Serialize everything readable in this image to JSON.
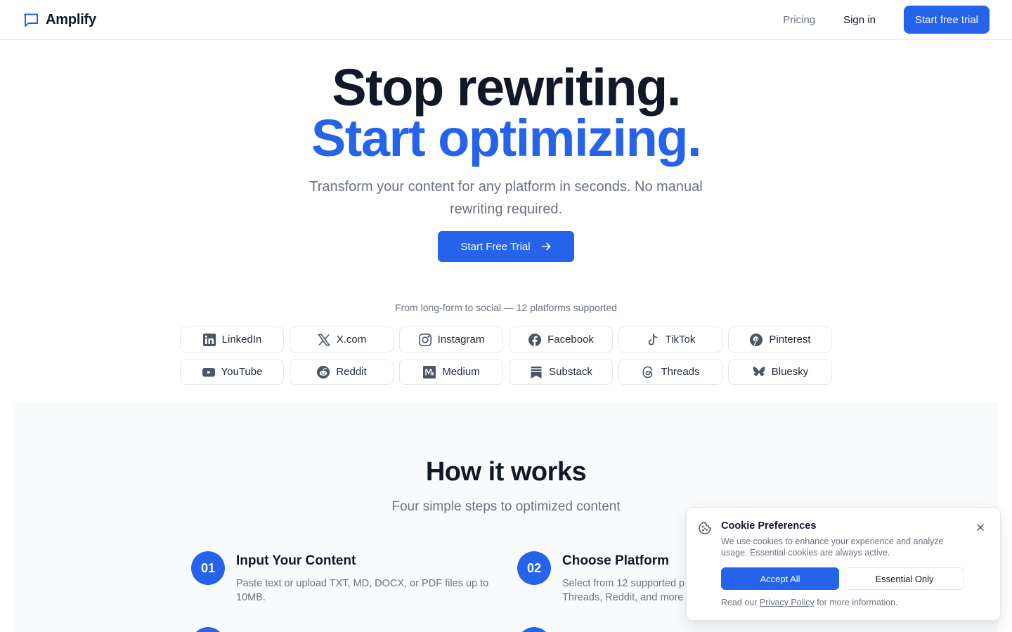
{
  "header": {
    "brand": "Amplify",
    "nav_pricing": "Pricing",
    "nav_signin": "Sign in",
    "cta": "Start free trial"
  },
  "hero": {
    "line1": "Stop rewriting.",
    "line2": "Start optimizing.",
    "subtitle": "Transform your content for any platform in seconds. No manual rewriting required.",
    "cta": "Start Free Trial"
  },
  "platforms": {
    "caption": "From long-form to social — 12 platforms supported",
    "items": [
      {
        "label": "LinkedIn",
        "icon": "linkedin-icon"
      },
      {
        "label": "X.com",
        "icon": "x-icon"
      },
      {
        "label": "Instagram",
        "icon": "instagram-icon"
      },
      {
        "label": "Facebook",
        "icon": "facebook-icon"
      },
      {
        "label": "TikTok",
        "icon": "tiktok-icon"
      },
      {
        "label": "Pinterest",
        "icon": "pinterest-icon"
      },
      {
        "label": "YouTube",
        "icon": "youtube-icon"
      },
      {
        "label": "Reddit",
        "icon": "reddit-icon"
      },
      {
        "label": "Medium",
        "icon": "medium-icon"
      },
      {
        "label": "Substack",
        "icon": "substack-icon"
      },
      {
        "label": "Threads",
        "icon": "threads-icon"
      },
      {
        "label": "Bluesky",
        "icon": "bluesky-icon"
      }
    ]
  },
  "how": {
    "title": "How it works",
    "subtitle": "Four simple steps to optimized content",
    "steps": [
      {
        "num": "01",
        "title": "Input Your Content",
        "desc": "Paste text or upload TXT, MD, DOCX, or PDF files up to 10MB."
      },
      {
        "num": "02",
        "title": "Choose Platform",
        "desc": "Select from 12 supported p Threads, Reddit, and more"
      }
    ]
  },
  "cookie": {
    "title": "Cookie Preferences",
    "text": "We use cookies to enhance your experience and analyze usage. Essential cookies are always active.",
    "accept": "Accept All",
    "essential": "Essential Only",
    "foot_before": "Read our",
    "foot_link": "Privacy Policy",
    "foot_after": "for more information."
  },
  "colors": {
    "accent": "#2563eb",
    "text": "#111827",
    "muted": "#6b7280",
    "border": "#e5e7eb",
    "section_bg": "#f9fafb"
  }
}
